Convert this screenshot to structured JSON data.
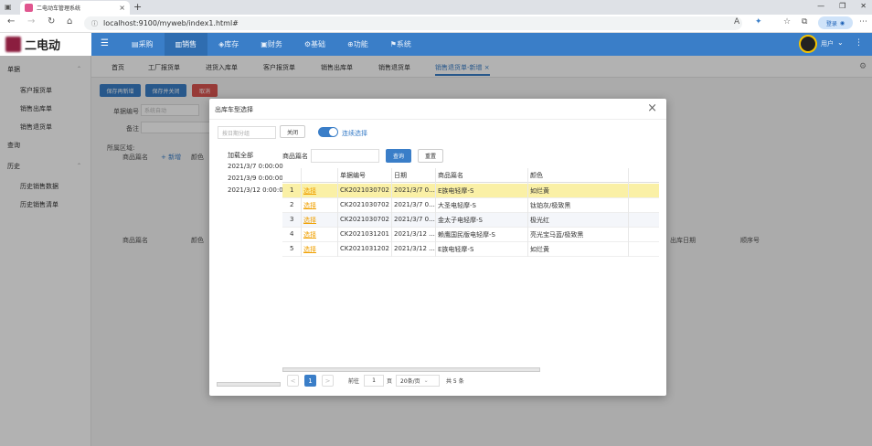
{
  "browser": {
    "tab_title": "二电动车管理系统",
    "url": "localhost:9100/myweb/index1.html#",
    "login_label": "登录"
  },
  "app": {
    "logo_text": "二电动",
    "nav": [
      "采购",
      "销售",
      "库存",
      "财务",
      "基础",
      "功能",
      "系统"
    ],
    "active_nav": "销售",
    "user_name": "用户"
  },
  "sidebar": {
    "group1": "单据",
    "items1": [
      "客户报货单",
      "销售出库单",
      "销售退货单"
    ],
    "query": "查询",
    "history": "历史",
    "items2": [
      "历史销售数据",
      "历史销售清单"
    ]
  },
  "page_tabs": [
    "首页",
    "工厂报货单",
    "进货入库单",
    "客户报货单",
    "销售出库单",
    "销售退货单",
    "销售退货单-新增"
  ],
  "form": {
    "buttons": [
      "保存再新增",
      "保存并关闭",
      "取消"
    ],
    "doc_no_label": "单据编号",
    "doc_no_placeholder": "系统自动",
    "remark_label": "备注",
    "area_label": "所属区域:",
    "grid_cols_top": [
      "商品篇名",
      "+ 新增",
      "颜色"
    ],
    "grid_cols_bottom": [
      "商品篇名",
      "颜色",
      "出库日期",
      "顺序号"
    ]
  },
  "modal": {
    "title": "出库车型选择",
    "group_placeholder": "按日期分组",
    "close_label": "关闭",
    "continuous_label": "连续选择",
    "dates": [
      "加载全部",
      "2021/3/7 0:00:00",
      "2021/3/9 0:00:00",
      "2021/3/12 0:00:00"
    ],
    "search_label": "商品篇名",
    "search_btn": "查询",
    "reset_btn": "重置",
    "columns": [
      "",
      "",
      "单据编号",
      "日期",
      "商品篇名",
      "颜色"
    ],
    "rows": [
      {
        "no": "1",
        "action": "选择",
        "doc": "CK2021030702",
        "date": "2021/3/7 0...",
        "name": "E族电轻摩-S",
        "color": "如烂黄"
      },
      {
        "no": "2",
        "action": "选择",
        "doc": "CK2021030702",
        "date": "2021/3/7 0...",
        "name": "大圣电轻摩-S",
        "color": "钛铂灰/极致黑"
      },
      {
        "no": "3",
        "action": "选择",
        "doc": "CK2021030702",
        "date": "2021/3/7 0...",
        "name": "金太子电轻摩-S",
        "color": "极光红"
      },
      {
        "no": "4",
        "action": "选择",
        "doc": "CK2021031201",
        "date": "2021/3/12 ...",
        "name": "赖鹰国民版电轻摩-S",
        "color": "亮光宝马蓝/极致黑"
      },
      {
        "no": "5",
        "action": "选择",
        "doc": "CK2021031202",
        "date": "2021/3/12 ...",
        "name": "E族电轻摩-S",
        "color": "如烂黄"
      }
    ],
    "pagination": {
      "prev": "<",
      "current_page": "1",
      "next": ">",
      "goto_label": "前往",
      "goto_value": "1",
      "page_unit": "页",
      "page_size": "20条/页",
      "total": "共 5 条"
    }
  },
  "colors": {
    "primary": "#3a7ec8",
    "danger": "#d9534f",
    "highlight_row": "#faf0a6",
    "link": "#f0a000"
  }
}
